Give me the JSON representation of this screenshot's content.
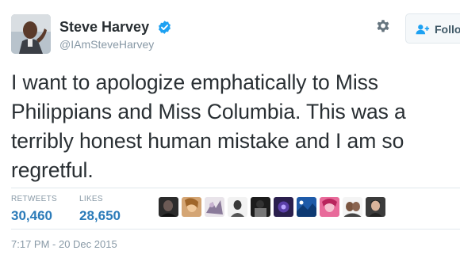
{
  "author": {
    "display_name": "Steve Harvey",
    "handle": "@IAmSteveHarvey",
    "verified_icon": "verified-badge-icon"
  },
  "actions": {
    "settings_icon": "gear-icon",
    "follow_label": "Follo",
    "follow_icon": "add-person-icon"
  },
  "tweet": {
    "text": "I want to apologize emphatically to Miss Philippians and Miss Columbia. This was a terribly honest human mistake and I am so regretful."
  },
  "stats": {
    "retweets_label": "RETWEETS",
    "retweets_value": "30,460",
    "likes_label": "LIKES",
    "likes_value": "28,650"
  },
  "timestamp": "7:17 PM - 20 Dec 2015",
  "colors": {
    "text": "#292f33",
    "muted": "#8899a6",
    "link": "#2b7bb9",
    "verified": "#1da1f2",
    "border": "#e1e8ed"
  }
}
